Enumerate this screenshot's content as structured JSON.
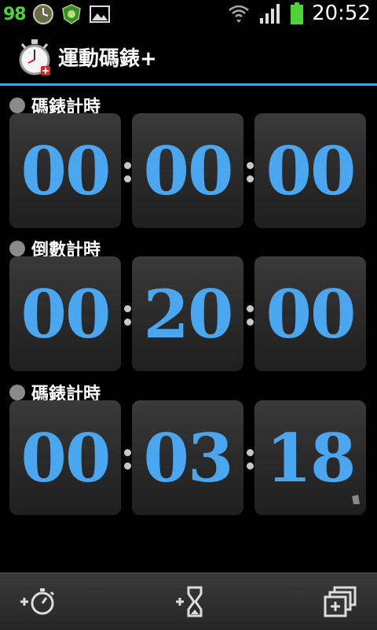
{
  "status": {
    "battery_percent": "98",
    "time": "20:52",
    "icons": [
      "clock-widget-icon",
      "shield-app-icon",
      "image-icon",
      "wifi-icon",
      "signal-icon",
      "battery-icon"
    ]
  },
  "app": {
    "title": "運動碼錶+",
    "icon": "stopwatch-icon",
    "accent_color": "#3ea8e3"
  },
  "timers": [
    {
      "label": "碼錶計時",
      "hours": "00",
      "minutes": "00",
      "seconds": "00"
    },
    {
      "label": "倒數計時",
      "hours": "00",
      "minutes": "20",
      "seconds": "00"
    },
    {
      "label": "碼錶計時",
      "hours": "00",
      "minutes": "03",
      "seconds": "18"
    }
  ],
  "bottom_bar": {
    "buttons": [
      "add-stopwatch-icon",
      "add-countdown-icon",
      "add-window-icon"
    ]
  },
  "colors": {
    "digit": "#4aa6ee",
    "battery_text": "#4cd437"
  }
}
